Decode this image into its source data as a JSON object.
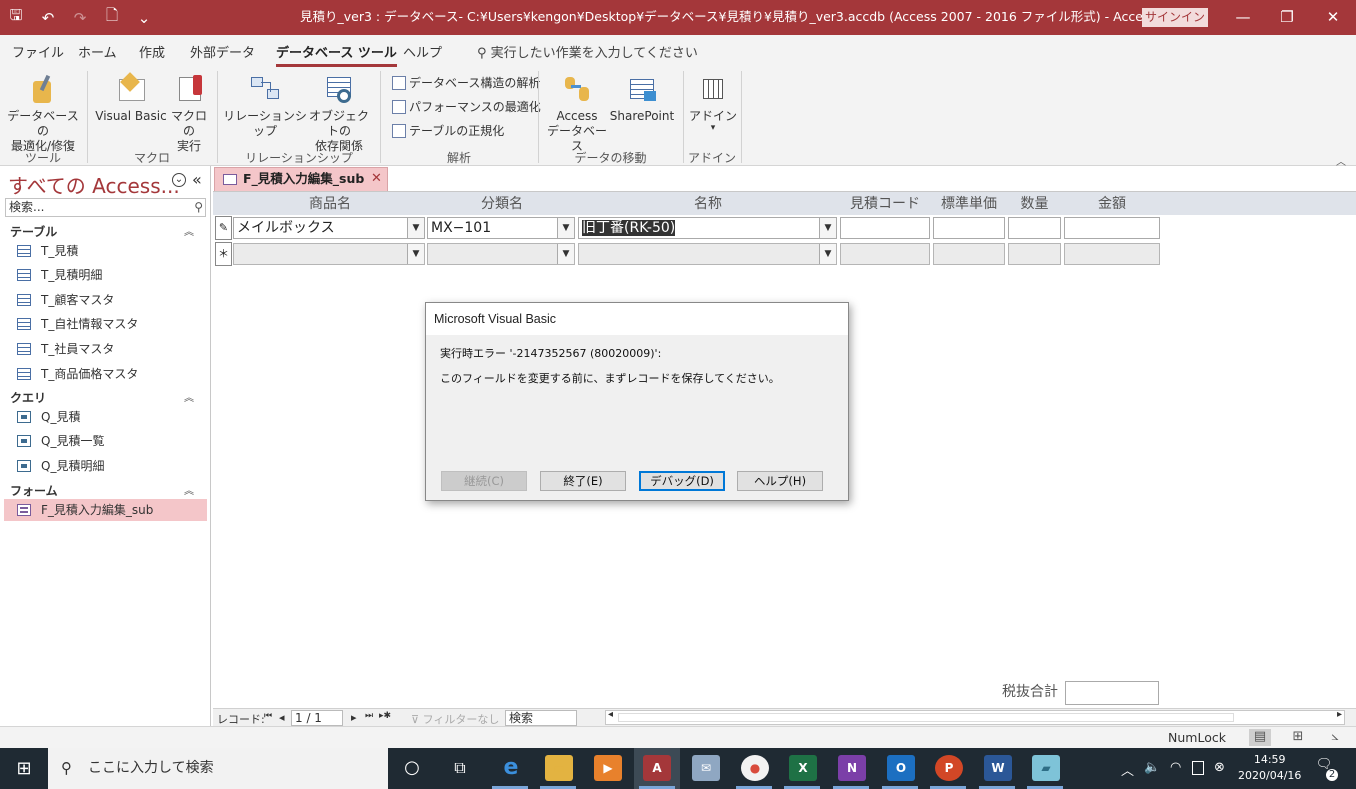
{
  "titlebar": {
    "title": "見積り_ver3 : データベース- C:¥Users¥kengon¥Desktop¥データベース¥見積り¥見積り_ver3.accdb (Access 2007 - 2016 ファイル形式) - Access",
    "signin": "サインイン",
    "qat_save": "🖫",
    "qat_undo": "↶",
    "qat_redo": "↷",
    "qat_preview": "🗋",
    "qat_more": "⌄",
    "minimize": "—",
    "restore": "❐",
    "close": "✕"
  },
  "ribbon_tabs": {
    "file": "ファイル",
    "home": "ホーム",
    "create": "作成",
    "external": "外部データ",
    "dbtools": "データベース ツール",
    "help": "ヘルプ",
    "tellme": "実行したい作業を入力してください"
  },
  "ribbon": {
    "compact_l1": "データベースの",
    "compact_l2": "最適化/修復",
    "vb": "Visual Basic",
    "macro_l1": "マクロの",
    "macro_l2": "実行",
    "relationships": "リレーションシップ",
    "objdep_l1": "オブジェクトの",
    "objdep_l2": "依存関係",
    "analyze_doc": "データベース構造の解析",
    "analyze_perf": "パフォーマンスの最適化",
    "analyze_table": "テーブルの正規化",
    "access_l1": "Access",
    "access_l2": "データベース",
    "sharepoint": "SharePoint",
    "addin": "アドイン",
    "addin_caret": "▾",
    "groups": {
      "tools": "ツール",
      "macro": "マクロ",
      "relationships": "リレーションシップ",
      "analyze": "解析",
      "move": "データの移動",
      "addins": "アドイン"
    },
    "collapse": "︿"
  },
  "nav": {
    "title": "すべての Access...",
    "menu_icon": "⌄",
    "shutter_icon": "«",
    "search_placeholder": "検索...",
    "groups": {
      "tables": {
        "label": "テーブル",
        "chev": "︽",
        "items": [
          "T_見積",
          "T_見積明細",
          "T_顧客マスタ",
          "T_自社情報マスタ",
          "T_社員マスタ",
          "T_商品価格マスタ"
        ]
      },
      "queries": {
        "label": "クエリ",
        "chev": "︽",
        "items": [
          "Q_見積",
          "Q_見積一覧",
          "Q_見積明細"
        ]
      },
      "forms": {
        "label": "フォーム",
        "chev": "︽",
        "items": [
          "F_見積入力編集_sub"
        ]
      }
    }
  },
  "document": {
    "tab_label": "F_見積入力編集_sub",
    "tab_close": "✕",
    "columns": [
      "商品名",
      "分類名",
      "名称",
      "見積コード",
      "標準単価",
      "数量",
      "金額"
    ],
    "row1": {
      "selector": "✎",
      "product": "メイルボックス",
      "category": "MX−101",
      "name": "旧丁番(RK-50)",
      "code": "",
      "price": "",
      "qty": "",
      "amount": ""
    },
    "newrow": {
      "selector": "＊"
    },
    "dropdown_glyph": "▼",
    "total_label": "税抜合計"
  },
  "recnav": {
    "label": "レコード:",
    "first": "⏮",
    "prev": "◂",
    "position": "1 / 1",
    "next": "▸",
    "last": "⏭",
    "new": "▸✱",
    "filter": "フィルターなし",
    "search": "検索"
  },
  "status": {
    "numlock": "NumLock",
    "view1": "▤",
    "view2": "⊞",
    "view3": "⦣"
  },
  "dialog": {
    "title": "Microsoft Visual Basic",
    "line1": "実行時エラー '-2147352567 (80020009)':",
    "line2": "このフィールドを変更する前に、まずレコードを保存してください。",
    "buttons": {
      "continue": "継続(C)",
      "end": "終了(E)",
      "debug": "デバッグ(D)",
      "help": "ヘルプ(H)"
    }
  },
  "taskbar": {
    "start": "⊞",
    "search_placeholder": "ここに入力して検索",
    "search_icon": "⚲",
    "apps": {
      "cortana": "○",
      "taskview": "⧉",
      "edge": "e",
      "explorer": "▭",
      "media": "▶",
      "access": "A",
      "mail": "✉",
      "chrome": "●",
      "excel": "X",
      "onenote": "N",
      "outlook": "O",
      "powerpoint": "P",
      "word": "W",
      "notes": "▰"
    },
    "tray": {
      "chevron": "︿",
      "volume": "🔈",
      "wifi": "◠",
      "close": "⊗"
    },
    "time": "14:59",
    "date": "2020/04/16",
    "notif": "🗨",
    "notif_count": "2"
  },
  "colors": {
    "accent": "#a4373a",
    "selection": "#f4c6c9",
    "taskbar": "#1f2a33",
    "default_button": "#0078d7"
  }
}
